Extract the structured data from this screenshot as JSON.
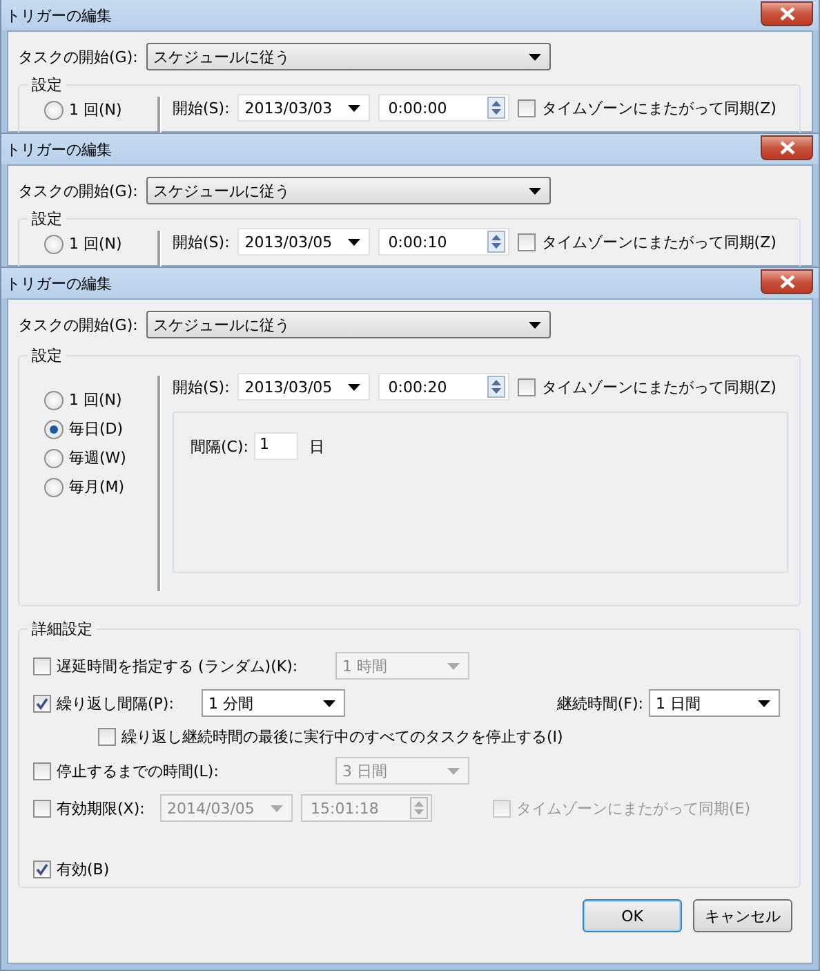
{
  "dialogs": [
    {
      "title": "トリガーの編集",
      "task_start_label": "タスクの開始(G):",
      "task_start_value": "スケジュールに従う",
      "settings_label": "設定",
      "schedules": [
        {
          "label": "1 回(N)",
          "selected": false
        }
      ],
      "start_label": "開始(S):",
      "start_date": "2013/03/03",
      "start_time": "0:00:00",
      "sync_tz": {
        "label": "タイムゾーンにまたがって同期(Z)",
        "checked": false
      }
    },
    {
      "title": "トリガーの編集",
      "task_start_label": "タスクの開始(G):",
      "task_start_value": "スケジュールに従う",
      "settings_label": "設定",
      "schedules": [
        {
          "label": "1 回(N)",
          "selected": false
        }
      ],
      "start_label": "開始(S):",
      "start_date": "2013/03/05",
      "start_time": "0:00:10",
      "sync_tz": {
        "label": "タイムゾーンにまたがって同期(Z)",
        "checked": false
      }
    },
    {
      "title": "トリガーの編集",
      "task_start_label": "タスクの開始(G):",
      "task_start_value": "スケジュールに従う",
      "settings_label": "設定",
      "schedules": [
        {
          "label": "1 回(N)",
          "selected": false
        },
        {
          "label": "毎日(D)",
          "selected": true
        },
        {
          "label": "毎週(W)",
          "selected": false
        },
        {
          "label": "毎月(M)",
          "selected": false
        }
      ],
      "start_label": "開始(S):",
      "start_date": "2013/03/05",
      "start_time": "0:00:20",
      "sync_tz": {
        "label": "タイムゾーンにまたがって同期(Z)",
        "checked": false
      },
      "interval": {
        "label": "間隔(C):",
        "value": "1",
        "unit": "日"
      },
      "details": {
        "label": "詳細設定",
        "delay": {
          "label": "遅延時間を指定する (ランダム)(K):",
          "checked": false,
          "value": "1 時間",
          "disabled": true
        },
        "repeat": {
          "label": "繰り返し間隔(P):",
          "checked": true,
          "value": "1 分間",
          "duration_label": "継続時間(F):",
          "duration_value": "1 日間"
        },
        "stop_all": {
          "label": "繰り返し継続時間の最後に実行中のすべてのタスクを停止する(I)",
          "checked": false
        },
        "stop_after": {
          "label": "停止するまでの時間(L):",
          "checked": false,
          "value": "3 日間",
          "disabled": true
        },
        "expire": {
          "label": "有効期限(X):",
          "checked": false,
          "date": "2014/03/05",
          "time": "15:01:18",
          "sync_label": "タイムゾーンにまたがって同期(E)",
          "sync_checked": false,
          "disabled": true
        },
        "enabled": {
          "label": "有効(B)",
          "checked": true
        }
      },
      "buttons": [
        {
          "label": "OK",
          "default": true
        },
        {
          "label": "キャンセル",
          "default": false
        }
      ]
    }
  ]
}
